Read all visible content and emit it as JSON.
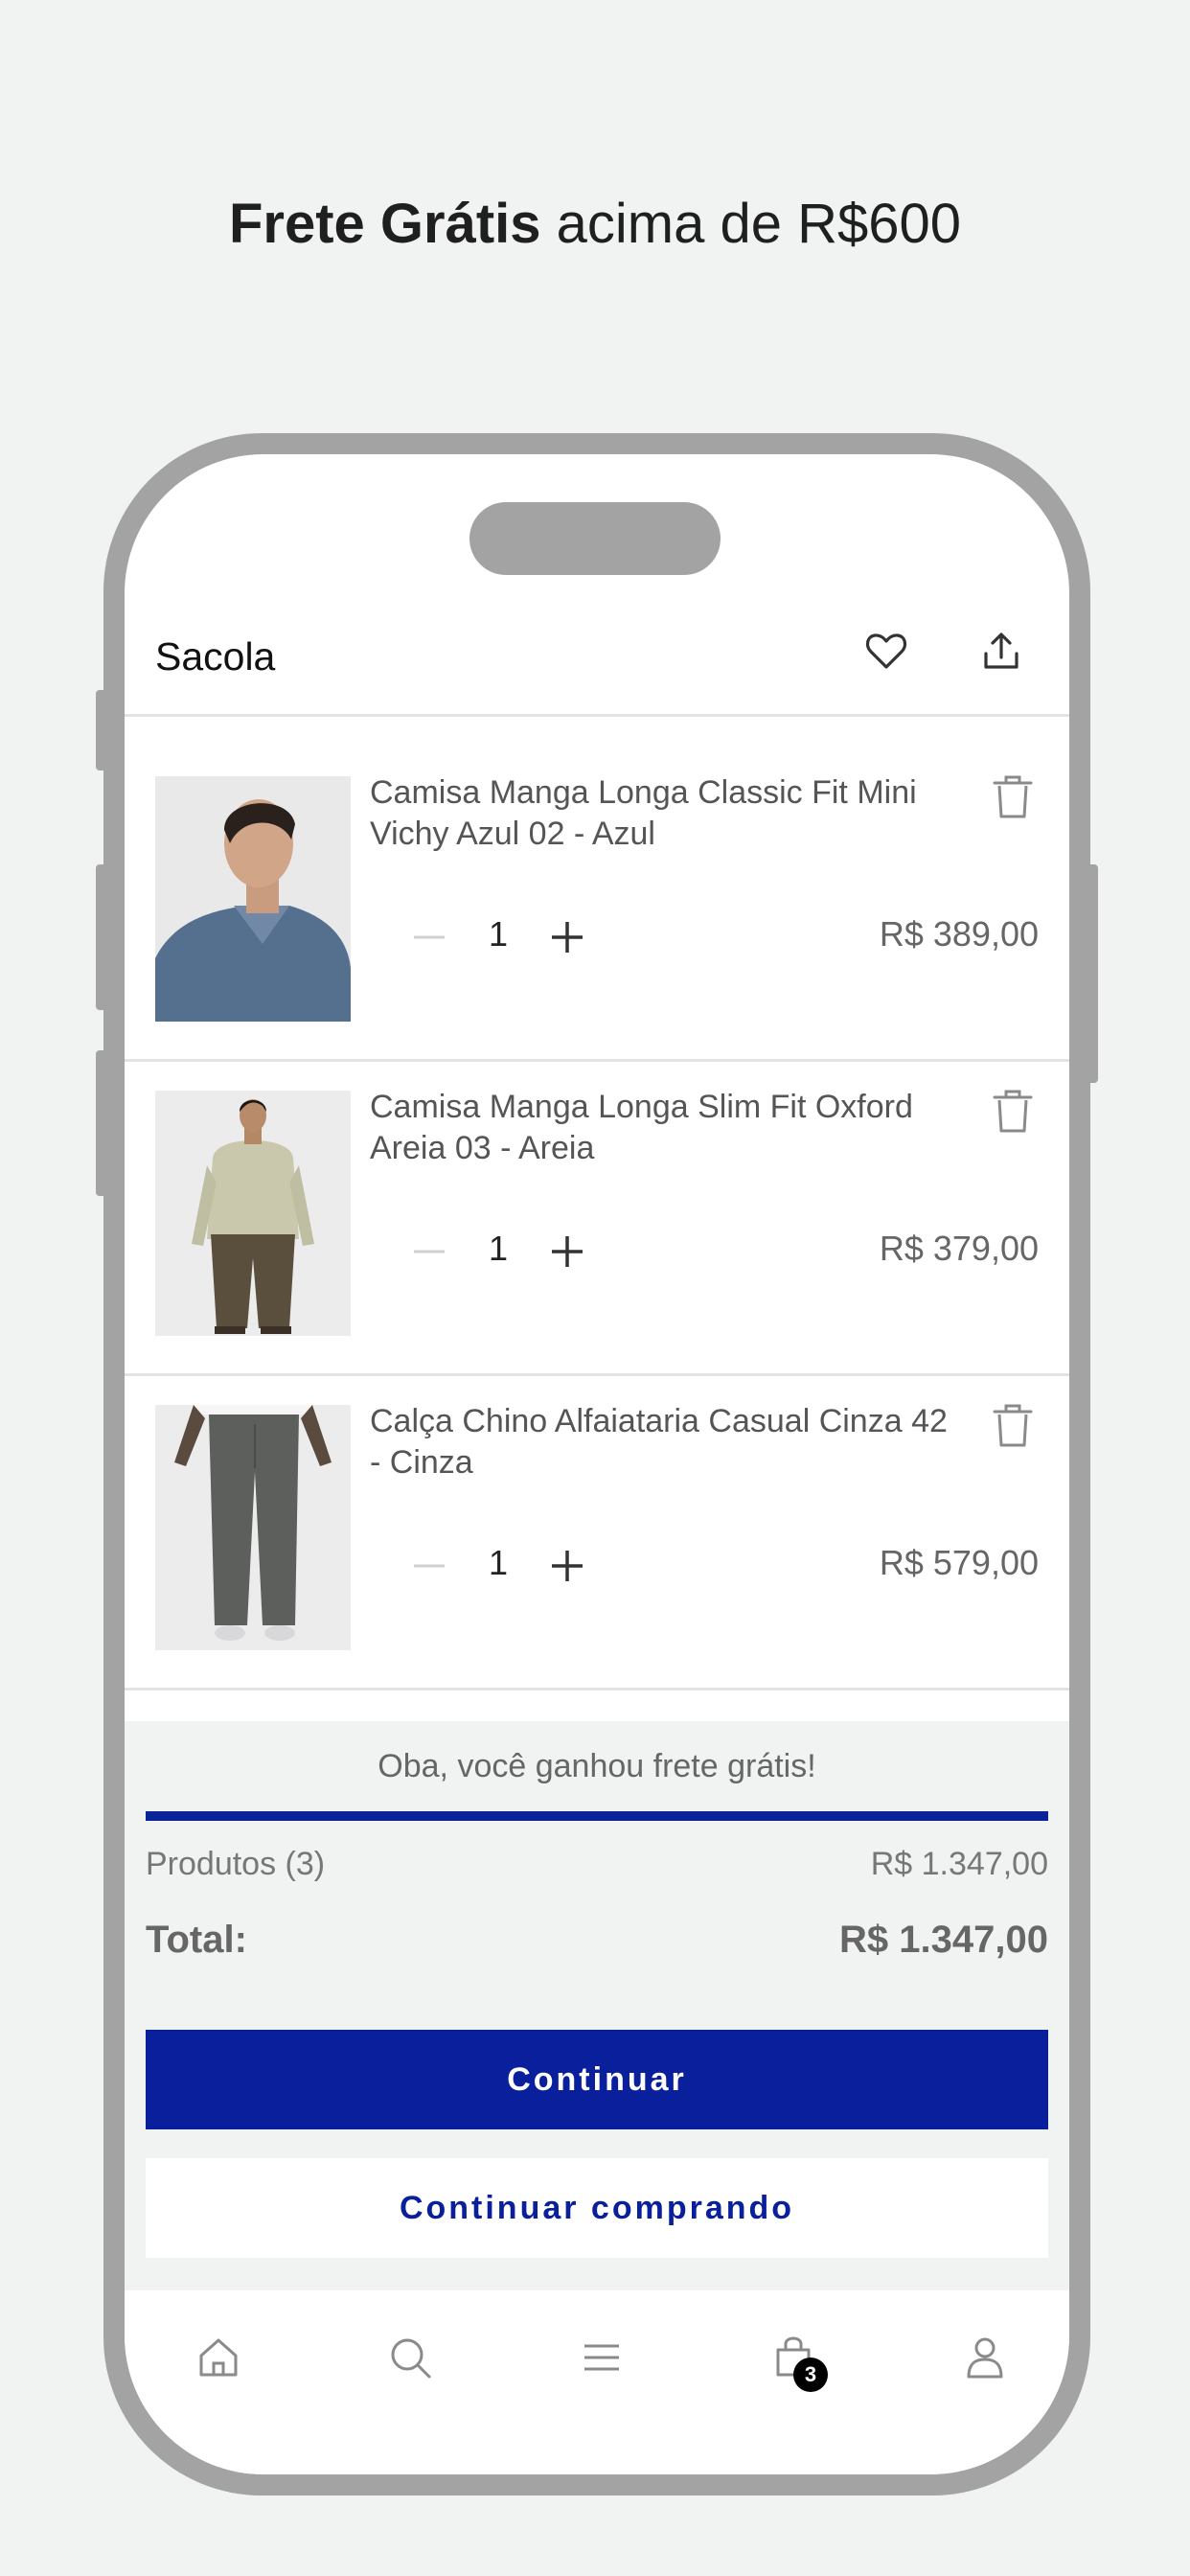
{
  "promo": {
    "bold": "Frete Grátis",
    "rest": " acima de R$600"
  },
  "header": {
    "title": "Sacola"
  },
  "items": [
    {
      "name": "Camisa Manga Longa Classic Fit Mini Vichy Azul 02 - Azul",
      "qty": "1",
      "price": "R$ 389,00"
    },
    {
      "name": "Camisa Manga Longa Slim Fit Oxford Areia 03 - Areia",
      "qty": "1",
      "price": "R$ 379,00"
    },
    {
      "name": "Calça Chino Alfaiataria Casual Cinza 42 - Cinza",
      "qty": "1",
      "price": "R$ 579,00"
    }
  ],
  "summary": {
    "free_shipping_msg": "Oba, você ganhou frete grátis!",
    "free_shipping_progress": 1.0,
    "products_label": "Produtos (3)",
    "products_value": "R$ 1.347,00",
    "total_label": "Total:",
    "total_value": "R$ 1.347,00"
  },
  "buttons": {
    "continue": "Continuar",
    "keep_shopping": "Continuar comprando"
  },
  "tabbar": {
    "cart_badge": "3"
  },
  "colors": {
    "brand_blue": "#0a1f9b"
  }
}
